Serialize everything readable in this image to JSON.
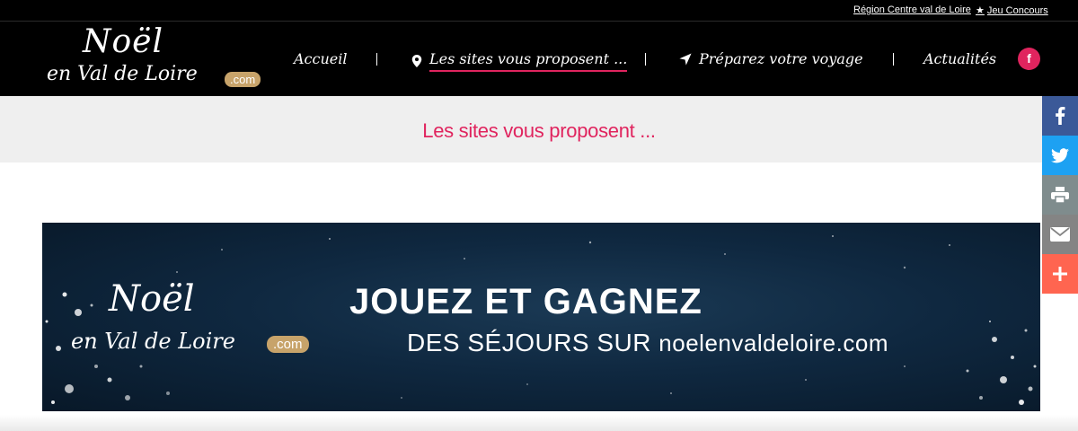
{
  "topbar": {
    "region_link": "Région Centre val de Loire",
    "jeu_link": "Jeu Concours"
  },
  "logo": {
    "line1": "Noël",
    "line2": "en Val de Loire",
    "suffix": ".com"
  },
  "nav": {
    "items": [
      {
        "label": "Accueil",
        "icon": null
      },
      {
        "label": "Les sites vous proposent ...",
        "icon": "map-pin-icon",
        "active": true
      },
      {
        "label": "Préparez votre voyage",
        "icon": "location-arrow-icon"
      },
      {
        "label": "Actualités",
        "icon": null
      }
    ],
    "facebook_letter": "f"
  },
  "page": {
    "title": "Les sites vous proposent ..."
  },
  "banner": {
    "logo_line1": "Noël",
    "logo_line2": "en Val de Loire",
    "logo_suffix": ".com",
    "headline": "JOUEZ ET GAGNEZ",
    "subline": "DES SÉJOURS SUR",
    "url": "noelenvaldeloire.com"
  },
  "share": {
    "buttons": [
      "facebook-icon",
      "twitter-icon",
      "print-icon",
      "email-icon",
      "plus-icon"
    ]
  },
  "colors": {
    "accent": "#e0245e",
    "header_bg": "#000000",
    "gold": "#c7a36a",
    "facebook": "#3b5998",
    "twitter": "#1da1f2",
    "print": "#7f8c8d",
    "email": "#848484",
    "more": "#ff6550"
  }
}
